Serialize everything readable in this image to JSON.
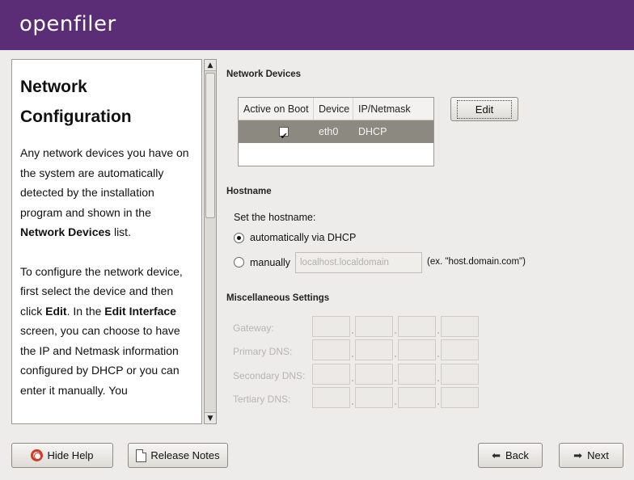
{
  "banner": {
    "logo_text": "openfiler"
  },
  "help": {
    "title_line1": "Network",
    "title_line2": "Configuration",
    "p1_a": "Any network devices you have on the system are automatically detected by the installation program and shown in the ",
    "p1_b": "Network Devices",
    "p1_c": " list.",
    "p2_a": "To configure the network device, first select the device and then click ",
    "p2_b": "Edit",
    "p2_c": ". In the ",
    "p2_d": "Edit Interface",
    "p2_e": " screen, you can choose to have the IP and Netmask information configured by DHCP or you can enter it manually. You"
  },
  "network_devices": {
    "title": "Network Devices",
    "columns": [
      "Active on Boot",
      "Device",
      "IP/Netmask"
    ],
    "rows": [
      {
        "active": true,
        "device": "eth0",
        "ip": "DHCP"
      }
    ],
    "edit_label": "Edit"
  },
  "hostname": {
    "title": "Hostname",
    "prompt": "Set the hostname:",
    "option_auto": "automatically via DHCP",
    "option_manual": "manually",
    "manual_value": "localhost.localdomain",
    "example": "(ex. \"host.domain.com\")",
    "selected": "auto"
  },
  "misc": {
    "title": "Miscellaneous Settings",
    "gateway": "Gateway:",
    "primary_dns": "Primary DNS:",
    "secondary_dns": "Secondary DNS:",
    "tertiary_dns": "Tertiary DNS:"
  },
  "buttons": {
    "hide_help": "Hide Help",
    "release_notes": "Release Notes",
    "back": "Back",
    "next": "Next"
  },
  "icons": {
    "hide_help": "lifebuoy-icon",
    "release_notes": "document-icon",
    "back": "arrow-left-icon",
    "next": "arrow-right-icon"
  },
  "colors": {
    "banner": "#5a2d76",
    "selected_row": "#8c8a80"
  }
}
